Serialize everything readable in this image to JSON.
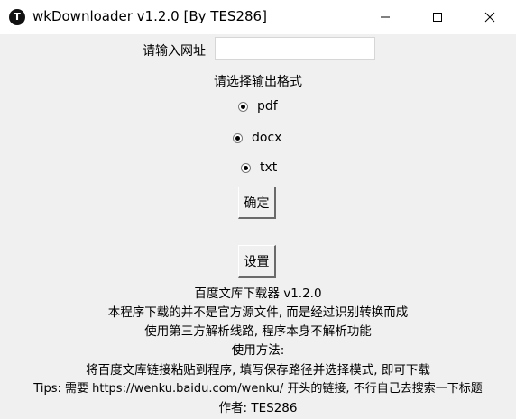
{
  "window": {
    "title": "wkDownloader v1.2.0 [By TES286]",
    "icon_letter": "T",
    "controls": {
      "minimize_icon": "minimize-icon",
      "maximize_icon": "maximize-icon",
      "close_icon": "close-icon"
    }
  },
  "form": {
    "url_label": "请输入网址",
    "url_value": "",
    "url_placeholder": "",
    "format_prompt": "请选择输出格式",
    "formats": [
      {
        "label": "pdf",
        "selected": true
      },
      {
        "label": "docx",
        "selected": true
      },
      {
        "label": "txt",
        "selected": true
      }
    ],
    "confirm_label": "确定",
    "settings_label": "设置"
  },
  "info": {
    "lines": [
      "百度文库下载器 v1.2.0",
      "本程序下载的并不是官方源文件, 而是经过识别转换而成",
      "使用第三方解析线路, 程序本身不解析功能",
      "使用方法:",
      "将百度文库链接粘贴到程序, 填写保存路径并选择模式, 即可下载",
      "Tips: 需要 https://wenku.baidu.com/wenku/ 开头的链接, 不行自己去搜索一下标题",
      "作者: TES286"
    ]
  }
}
